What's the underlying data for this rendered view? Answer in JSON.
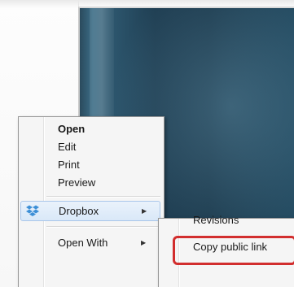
{
  "context_menu": {
    "items": [
      {
        "label": "Open",
        "bold": true
      },
      {
        "label": "Edit"
      },
      {
        "label": "Print"
      },
      {
        "label": "Preview"
      },
      {
        "label": "Dropbox",
        "icon": "dropbox-icon",
        "has_submenu": true,
        "highlighted": true
      },
      {
        "label": "Open With",
        "has_submenu": true
      }
    ]
  },
  "dropbox_submenu": {
    "items": [
      {
        "label": "Revisions"
      },
      {
        "label": "Copy public link",
        "annotated": true
      }
    ]
  },
  "colors": {
    "annotation": "#d22e2e",
    "hover_background": "#d9e8f8",
    "hover_border": "#a9c6ea",
    "dropbox_blue": "#3d8fd6"
  }
}
